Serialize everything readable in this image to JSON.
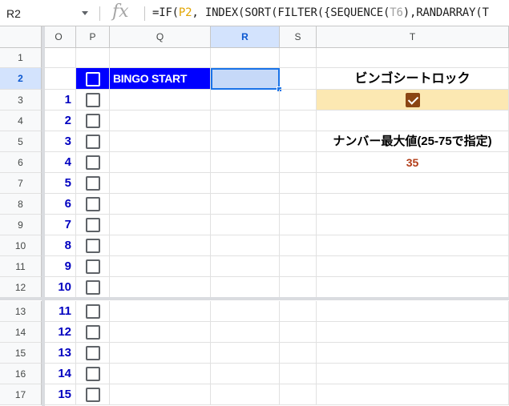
{
  "formula_bar": {
    "name_box": "R2",
    "fx_label": "fx",
    "formula_prefix": "=IF(",
    "formula_ref1": "P2",
    "formula_mid": ", INDEX(SORT(FILTER({SEQUENCE(",
    "formula_ref2": "T6",
    "formula_suffix": "),RANDARRAY(T"
  },
  "columns": [
    "O",
    "P",
    "Q",
    "R",
    "S",
    "T"
  ],
  "selected_column": "R",
  "rows": [
    "1",
    "2",
    "3",
    "4",
    "5",
    "6",
    "7",
    "8",
    "9",
    "10",
    "11",
    "12",
    "13",
    "14",
    "15",
    "16",
    "17"
  ],
  "selected_row": "2",
  "numbers": [
    "1",
    "2",
    "3",
    "4",
    "5",
    "6",
    "7",
    "8",
    "9",
    "10",
    "11",
    "12",
    "13",
    "14",
    "15"
  ],
  "bingo_start_label": "BINGO START",
  "lock_title": "ビンゴシートロック",
  "lock_checked": true,
  "max_label": "ナンバー最大値(25-75で指定)",
  "max_value": "35",
  "colors": {
    "bingo_bg": "#0000ff",
    "number_text": "#0000c0",
    "lock_bg": "#fce8b2",
    "checkbox_checked": "#8b4513",
    "max_value_text": "#b23c17",
    "selection_fill": "#c6d9f8",
    "selection_border": "#1a73e8"
  }
}
